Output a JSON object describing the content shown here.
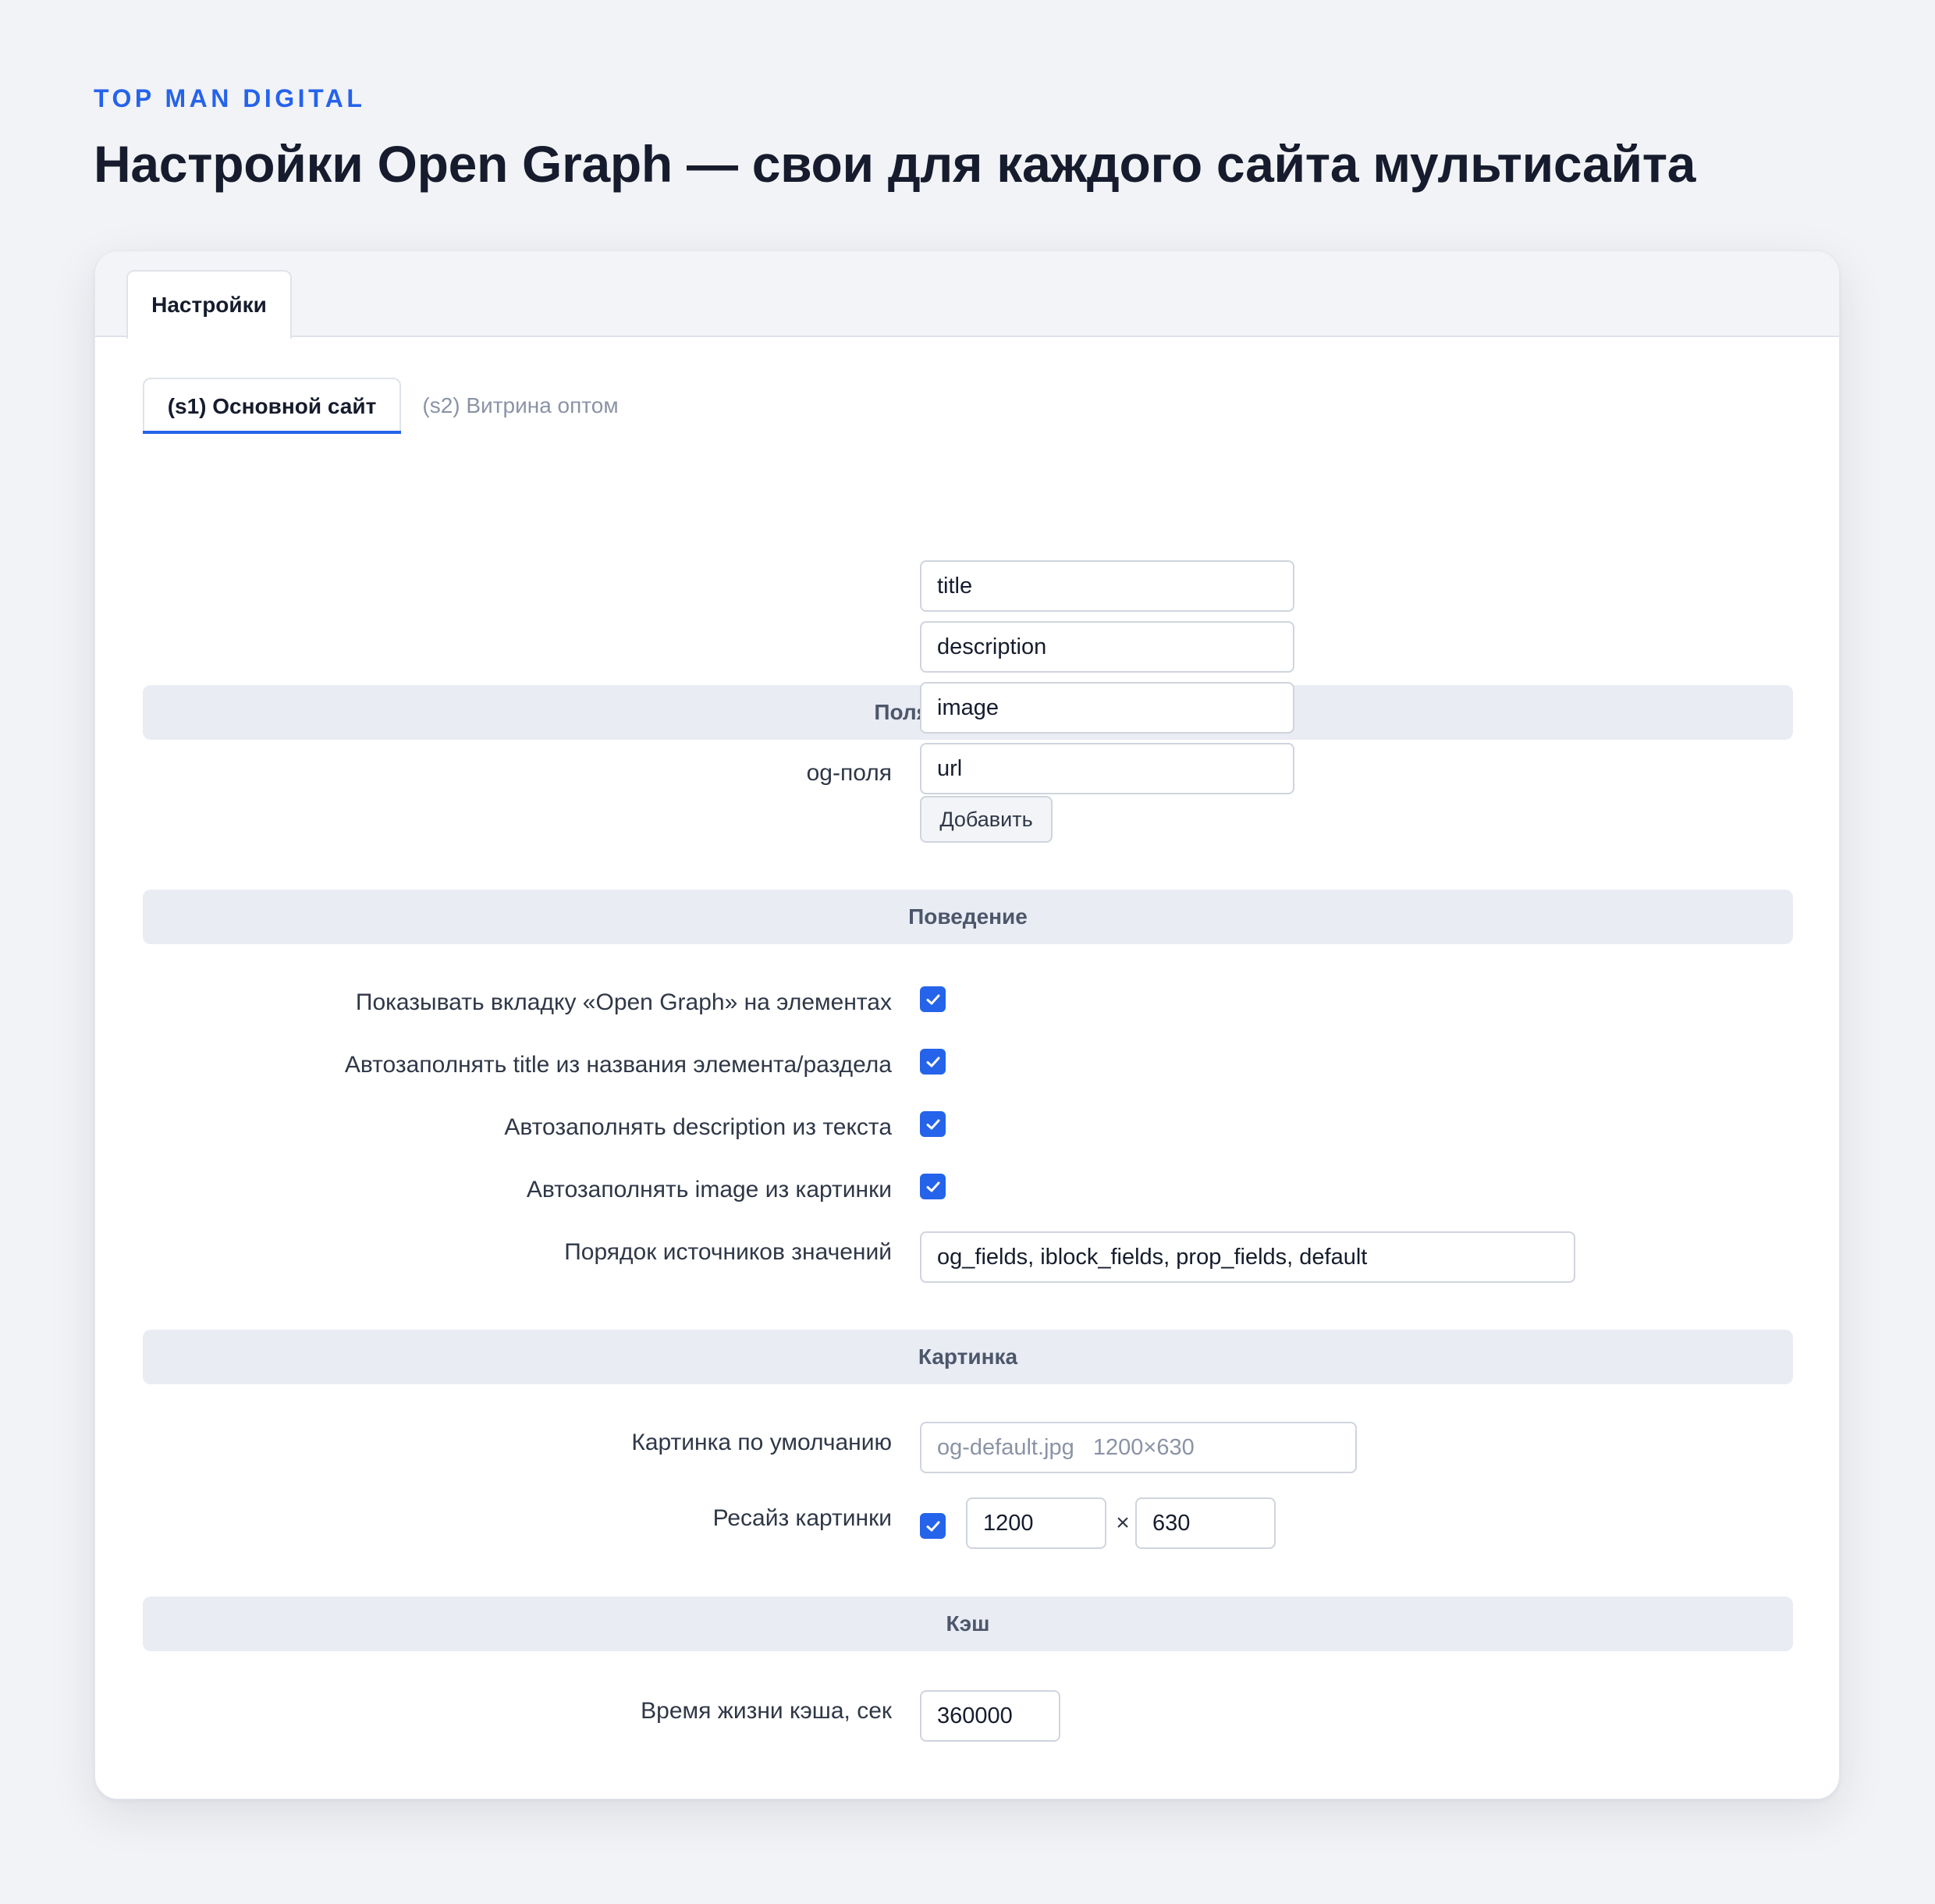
{
  "brand": "TOP MAN DIGITAL",
  "page_title": "Настройки Open Graph — свои для каждого сайта мультисайта",
  "top_tab": "Настройки",
  "site_tabs": [
    {
      "label": "(s1) Основной сайт",
      "active": true
    },
    {
      "label": "(s2) Витрина оптом",
      "active": false
    }
  ],
  "sections": {
    "og_fields": {
      "title": "Поля Open Graph",
      "label": "og-поля",
      "fields": [
        "title",
        "description",
        "image",
        "url"
      ],
      "add_button": "Добавить"
    },
    "behavior": {
      "title": "Поведение",
      "show_tab_label": "Показывать вкладку «Open Graph» на элементах",
      "show_tab_checked": true,
      "autofill_title_label": "Автозаполнять title из названия элемента/раздела",
      "autofill_title_checked": true,
      "autofill_description_label": "Автозаполнять description из текста",
      "autofill_description_checked": true,
      "autofill_image_label": "Автозаполнять image из картинки",
      "autofill_image_checked": true,
      "source_order_label": "Порядок источников значений",
      "source_order_value": "og_fields, iblock_fields, prop_fields, default"
    },
    "image": {
      "title": "Картинка",
      "default_image_label": "Картинка по умолчанию",
      "default_image_placeholder": "og-default.jpg   1200×630",
      "resize_label": "Ресайз картинки",
      "resize_checked": true,
      "resize_width": "1200",
      "resize_separator": "×",
      "resize_height": "630"
    },
    "cache": {
      "title": "Кэш",
      "ttl_label": "Время жизни кэша, сек",
      "ttl_value": "360000"
    }
  },
  "colors": {
    "accent": "#2563eb",
    "section_bg": "#e9ecf3",
    "page_bg": "#f2f3f6"
  }
}
